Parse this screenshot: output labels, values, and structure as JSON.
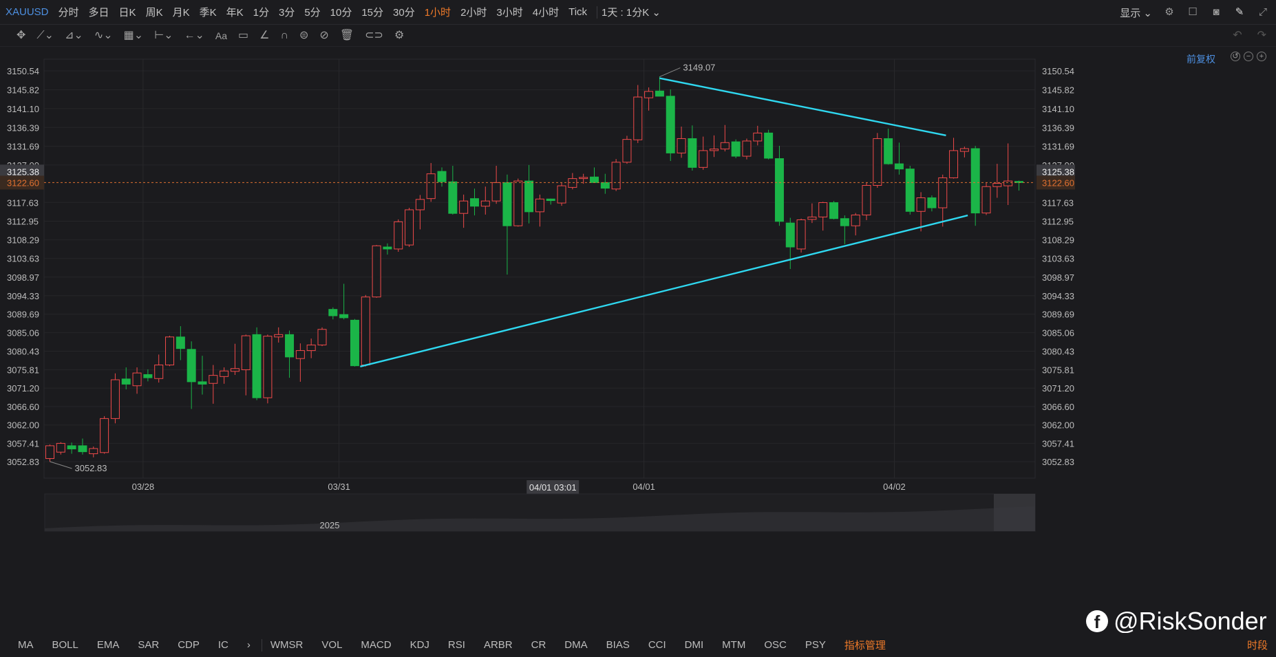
{
  "toolbar": {
    "symbol": "XAUUSD",
    "periods": [
      "分时",
      "多日",
      "日K",
      "周K",
      "月K",
      "季K",
      "年K",
      "1分",
      "3分",
      "5分",
      "10分",
      "15分",
      "30分",
      "1小时",
      "2小时",
      "3小时",
      "4小时",
      "Tick"
    ],
    "active_period": "1小时",
    "kline_mode": "1天 : 1分K",
    "display_label": "显示",
    "icons": [
      "settings-icon",
      "layout-icon",
      "camera-icon",
      "pen-icon",
      "fullscreen-icon"
    ]
  },
  "draw_tools": [
    "move-icon",
    "line-icon",
    "channel-icon",
    "wave-icon",
    "fib-icon",
    "measure-icon",
    "arrow-icon",
    "text-icon",
    "comment-icon",
    "brush-icon",
    "magnet-icon",
    "lock-icon",
    "hide-icon",
    "trash-icon",
    "link-icon",
    "gear-icon"
  ],
  "chart_header": {
    "adjust_label": "前复权"
  },
  "colors": {
    "up": "#f04a4a",
    "down": "#1bb548",
    "trendline": "#2fd8f0",
    "price_line": "#e07030",
    "accent": "#ef7a29",
    "link": "#4d8fe0"
  },
  "chart_data": {
    "type": "candlestick",
    "ylim": [
      3048.9,
      3152.9
    ],
    "yticks": [
      "3150.54",
      "3145.82",
      "3141.10",
      "3136.39",
      "3131.69",
      "3127.00",
      "3117.63",
      "3112.95",
      "3108.29",
      "3103.63",
      "3098.97",
      "3094.33",
      "3089.69",
      "3085.06",
      "3080.43",
      "3075.81",
      "3071.20",
      "3066.60",
      "3062.00",
      "3057.41",
      "3052.83"
    ],
    "x_labels": [
      {
        "label": "03/28",
        "index": 9
      },
      {
        "label": "03/31",
        "index": 27
      },
      {
        "label": "04/01",
        "index": 55
      },
      {
        "label": "04/02",
        "index": 78
      }
    ],
    "crosshair_time": "04/01 03:01",
    "crosshair_index": 46,
    "last_price": "3122.60",
    "hover_price": "3125.38",
    "annotations": [
      {
        "text": "3149.07",
        "index": 56,
        "price": 3149.07
      },
      {
        "text": "3052.83",
        "index": 0,
        "price": 3052.83
      }
    ],
    "trendlines": [
      {
        "from": {
          "index": 28.5,
          "price": 3076.6
        },
        "to": {
          "index": 84.3,
          "price": 3114.4
        }
      },
      {
        "from": {
          "index": 56,
          "price": 3148.7
        },
        "to": {
          "index": 82.3,
          "price": 3134.4
        }
      }
    ],
    "candles": [
      [
        3053.6,
        3057.1,
        3052.8,
        3056.8
      ],
      [
        3055.2,
        3057.7,
        3054.6,
        3057.4
      ],
      [
        3056.8,
        3057.6,
        3054.8,
        3056.0
      ],
      [
        3056.8,
        3058.6,
        3054.6,
        3055.3
      ],
      [
        3054.8,
        3056.6,
        3053.9,
        3056.1
      ],
      [
        3055.1,
        3064.2,
        3054.8,
        3063.6
      ],
      [
        3063.6,
        3074.9,
        3062.4,
        3073.3
      ],
      [
        3073.5,
        3076.4,
        3070.9,
        3072.2
      ],
      [
        3071.8,
        3076.4,
        3069.8,
        3075.0
      ],
      [
        3074.6,
        3075.9,
        3072.9,
        3073.8
      ],
      [
        3073.6,
        3079.6,
        3072.6,
        3077.0
      ],
      [
        3077.0,
        3084.3,
        3076.7,
        3084.0
      ],
      [
        3084.0,
        3086.7,
        3078.2,
        3081.1
      ],
      [
        3080.9,
        3082.9,
        3066.0,
        3072.8
      ],
      [
        3072.8,
        3079.3,
        3069.6,
        3072.2
      ],
      [
        3072.4,
        3077.0,
        3067.3,
        3074.4
      ],
      [
        3074.1,
        3076.4,
        3072.3,
        3075.5
      ],
      [
        3075.4,
        3082.3,
        3074.5,
        3076.1
      ],
      [
        3075.8,
        3084.6,
        3069.4,
        3084.3
      ],
      [
        3084.6,
        3086.4,
        3068.2,
        3068.8
      ],
      [
        3068.8,
        3084.6,
        3067.4,
        3084.2
      ],
      [
        3084.0,
        3086.4,
        3082.6,
        3084.6
      ],
      [
        3084.6,
        3085.6,
        3073.8,
        3079.0
      ],
      [
        3078.6,
        3082.4,
        3072.8,
        3080.6
      ],
      [
        3080.6,
        3083.6,
        3078.7,
        3082.0
      ],
      [
        3082.0,
        3086.4,
        3081.7,
        3085.9
      ],
      [
        3090.9,
        3091.4,
        3088.4,
        3089.3
      ],
      [
        3089.6,
        3097.3,
        3088.4,
        3088.8
      ],
      [
        3088.2,
        3088.5,
        3076.6,
        3076.8
      ],
      [
        3077.0,
        3094.5,
        3076.6,
        3094.0
      ],
      [
        3094.0,
        3107.0,
        3093.8,
        3106.8
      ],
      [
        3106.5,
        3107.4,
        3104.6,
        3106.0
      ],
      [
        3106.0,
        3113.4,
        3105.3,
        3112.8
      ],
      [
        3107.0,
        3116.3,
        3106.5,
        3115.8
      ],
      [
        3115.8,
        3119.5,
        3110.9,
        3118.4
      ],
      [
        3118.6,
        3127.5,
        3117.8,
        3124.8
      ],
      [
        3125.4,
        3126.4,
        3121.6,
        3122.8
      ],
      [
        3122.8,
        3126.8,
        3114.6,
        3114.9
      ],
      [
        3114.9,
        3119.6,
        3111.3,
        3118.0
      ],
      [
        3118.6,
        3121.1,
        3114.4,
        3116.7
      ],
      [
        3116.7,
        3121.6,
        3114.6,
        3118.0
      ],
      [
        3118.0,
        3126.8,
        3117.3,
        3122.6
      ],
      [
        3122.6,
        3124.6,
        3099.6,
        3111.8
      ],
      [
        3111.8,
        3123.6,
        3111.6,
        3123.0
      ],
      [
        3123.0,
        3127.0,
        3112.4,
        3115.3
      ],
      [
        3115.3,
        3119.6,
        3111.6,
        3118.5
      ],
      [
        3118.5,
        3118.6,
        3117.1,
        3118.1
      ],
      [
        3117.5,
        3122.6,
        3116.8,
        3121.8
      ],
      [
        3121.4,
        3125.0,
        3120.9,
        3123.6
      ],
      [
        3123.6,
        3124.8,
        3122.3,
        3123.9
      ],
      [
        3124.0,
        3126.4,
        3122.8,
        3122.6
      ],
      [
        3122.6,
        3124.8,
        3119.8,
        3121.2
      ],
      [
        3121.0,
        3128.5,
        3120.5,
        3127.7
      ],
      [
        3127.7,
        3134.3,
        3127.3,
        3133.4
      ],
      [
        3133.3,
        3147.0,
        3132.5,
        3144.0
      ],
      [
        3143.8,
        3146.4,
        3140.6,
        3145.4
      ],
      [
        3145.5,
        3149.1,
        3144.9,
        3144.2
      ],
      [
        3144.2,
        3145.9,
        3128.0,
        3130.0
      ],
      [
        3130.0,
        3136.6,
        3128.8,
        3133.6
      ],
      [
        3133.6,
        3136.9,
        3125.6,
        3126.4
      ],
      [
        3126.4,
        3134.1,
        3125.8,
        3130.6
      ],
      [
        3130.6,
        3134.4,
        3129.0,
        3131.0
      ],
      [
        3131.0,
        3137.0,
        3130.4,
        3132.6
      ],
      [
        3132.8,
        3133.4,
        3128.7,
        3129.2
      ],
      [
        3129.2,
        3133.6,
        3128.4,
        3133.0
      ],
      [
        3133.0,
        3136.8,
        3131.9,
        3135.0
      ],
      [
        3135.0,
        3135.8,
        3128.4,
        3128.7
      ],
      [
        3128.6,
        3131.8,
        3111.8,
        3112.9
      ],
      [
        3112.5,
        3113.8,
        3101.0,
        3106.5
      ],
      [
        3106.0,
        3113.6,
        3105.1,
        3113.3
      ],
      [
        3113.4,
        3117.4,
        3112.5,
        3114.0
      ],
      [
        3114.0,
        3117.8,
        3110.6,
        3117.6
      ],
      [
        3117.6,
        3118.0,
        3113.4,
        3113.6
      ],
      [
        3113.6,
        3114.4,
        3107.2,
        3111.8
      ],
      [
        3111.8,
        3115.0,
        3109.4,
        3114.5
      ],
      [
        3114.5,
        3122.6,
        3113.2,
        3121.9
      ],
      [
        3121.9,
        3135.0,
        3121.3,
        3133.6
      ],
      [
        3133.6,
        3136.1,
        3127.1,
        3127.3
      ],
      [
        3127.3,
        3132.6,
        3124.6,
        3126.0
      ],
      [
        3126.0,
        3126.8,
        3114.6,
        3115.4
      ],
      [
        3115.4,
        3120.2,
        3110.4,
        3118.8
      ],
      [
        3118.8,
        3119.4,
        3115.4,
        3116.3
      ],
      [
        3116.3,
        3124.6,
        3111.6,
        3123.8
      ],
      [
        3123.8,
        3133.8,
        3123.6,
        3130.6
      ],
      [
        3130.4,
        3131.6,
        3128.9,
        3131.1
      ],
      [
        3131.1,
        3131.8,
        3111.8,
        3115.0
      ],
      [
        3115.0,
        3122.6,
        3114.5,
        3121.6
      ],
      [
        3121.6,
        3127.3,
        3118.8,
        3122.4
      ],
      [
        3121.8,
        3132.4,
        3117.0,
        3123.0
      ],
      [
        3122.9,
        3123.1,
        3120.6,
        3122.6
      ]
    ]
  },
  "navigator": {
    "year_label": "2025"
  },
  "indicators": [
    "MA",
    "BOLL",
    "EMA",
    "SAR",
    "CDP",
    "IC",
    "WMSR",
    "VOL",
    "MACD",
    "KDJ",
    "RSI",
    "ARBR",
    "CR",
    "DMA",
    "BIAS",
    "CCI",
    "DMI",
    "MTM",
    "OSC",
    "PSY"
  ],
  "indicator_manage": "指标管理",
  "indicator_arrow": "›",
  "time_segment": "时段",
  "watermark": {
    "logo_letter": "f",
    "handle": "@RiskSonder"
  }
}
